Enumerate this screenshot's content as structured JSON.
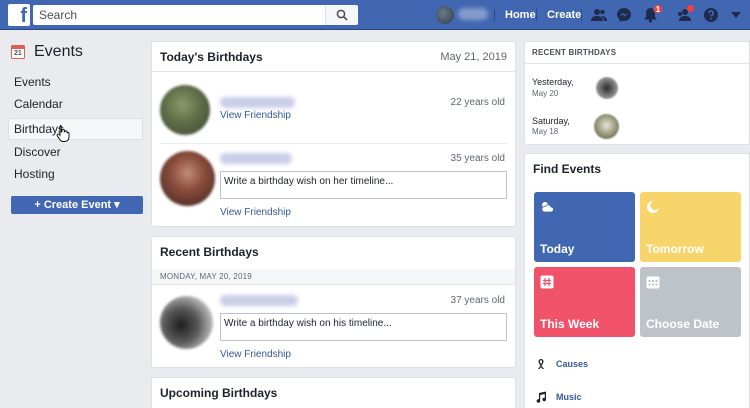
{
  "topbar": {
    "logo": "f",
    "search_placeholder": "Search",
    "home": "Home",
    "create": "Create",
    "notification_count": "1",
    "colors": {
      "bar": "#4267b2"
    }
  },
  "nav": {
    "title": "Events",
    "calendar_icon_day": "21",
    "items": [
      "Events",
      "Calendar",
      "Birthdays",
      "Discover",
      "Hosting"
    ],
    "create_button": "+ Create Event ▾"
  },
  "today": {
    "title": "Today's Birthdays",
    "date": "May 21, 2019",
    "people": [
      {
        "age": "22 years old",
        "link": "View Friendship"
      },
      {
        "age": "35 years old",
        "placeholder": "Write a birthday wish on her timeline...",
        "link": "View Friendship"
      }
    ]
  },
  "recent": {
    "title": "Recent Birthdays",
    "subheader": "MONDAY, MAY 20, 2019",
    "people": [
      {
        "age": "37 years old",
        "placeholder": "Write a birthday wish on his timeline...",
        "link": "View Friendship"
      }
    ]
  },
  "upcoming": {
    "title": "Upcoming Birthdays"
  },
  "right_recent": {
    "title": "RECENT BIRTHDAYS",
    "items": [
      {
        "day": "Yesterday,",
        "date": "May 20"
      },
      {
        "day": "Saturday,",
        "date": "May 18"
      }
    ]
  },
  "find_events": {
    "title": "Find Events",
    "tiles": [
      {
        "label": "Today",
        "color": "#4267b2"
      },
      {
        "label": "Tomorrow",
        "color": "#f7d56b"
      },
      {
        "label": "This Week",
        "color": "#f0526a"
      },
      {
        "label": "Choose Date",
        "color": "#bec3c9"
      }
    ],
    "list": [
      "Causes",
      "Music"
    ]
  }
}
